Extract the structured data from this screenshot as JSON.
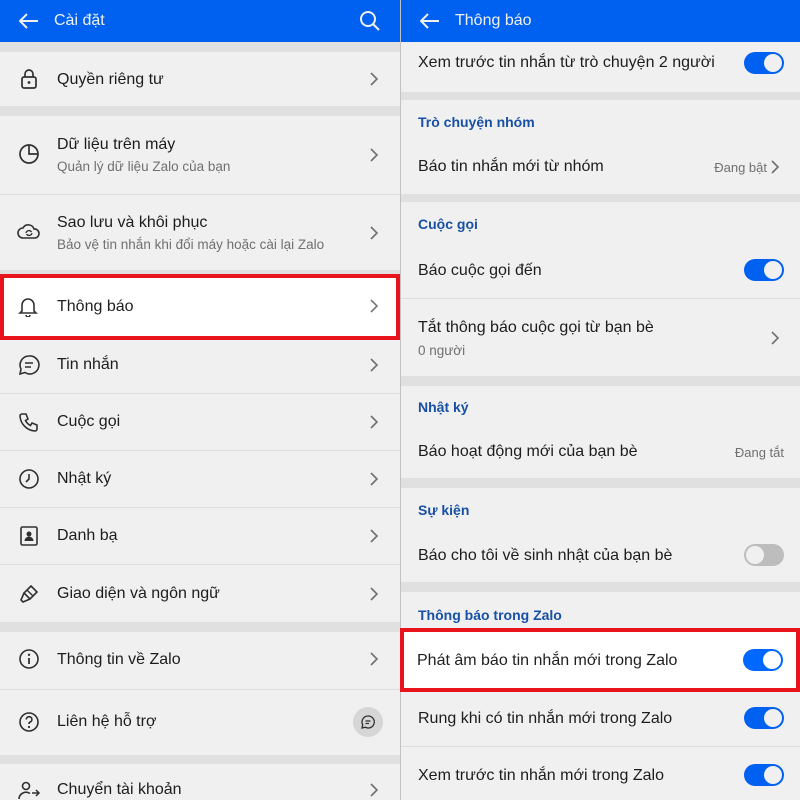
{
  "left": {
    "title": "Cài đặt",
    "items": [
      {
        "label": "Quyền riêng tư",
        "icon": "lock-icon"
      },
      {
        "label": "Dữ liệu trên máy",
        "sub": "Quản lý dữ liệu Zalo của bạn",
        "icon": "pie-chart-icon"
      },
      {
        "label": "Sao lưu và khôi phục",
        "sub": "Bảo vệ tin nhắn khi đổi máy hoặc cài lại Zalo",
        "icon": "cloud-sync-icon"
      },
      {
        "label": "Thông báo",
        "icon": "bell-icon"
      },
      {
        "label": "Tin nhắn",
        "icon": "chat-bubble-icon"
      },
      {
        "label": "Cuộc gọi",
        "icon": "phone-icon"
      },
      {
        "label": "Nhật ký",
        "icon": "clock-icon"
      },
      {
        "label": "Danh bạ",
        "icon": "contact-book-icon"
      },
      {
        "label": "Giao diện và ngôn ngữ",
        "icon": "paint-brush-icon"
      },
      {
        "label": "Thông tin về Zalo",
        "icon": "info-icon"
      },
      {
        "label": "Liên hệ hỗ trợ",
        "icon": "help-icon"
      },
      {
        "label": "Chuyển tài khoản",
        "icon": "switch-account-icon"
      }
    ]
  },
  "right": {
    "title": "Thông báo",
    "rows": {
      "preview_direct": "Xem trước tin nhắn từ trò chuyện 2 người",
      "group_section": "Trò chuyện nhóm",
      "group_new": "Báo tin nhắn mới từ nhóm",
      "group_new_status": "Đang bật",
      "call_section": "Cuộc gọi",
      "incoming_call": "Báo cuộc gọi đến",
      "mute_calls": "Tắt thông báo cuộc gọi từ bạn bè",
      "mute_calls_sub": "0 người",
      "diary_section": "Nhật ký",
      "friend_activity": "Báo hoạt động mới của bạn bè",
      "friend_activity_status": "Đang tắt",
      "event_section": "Sự kiện",
      "birthday": "Báo cho tôi về sinh nhật của bạn bè",
      "in_app_section": "Thông báo trong Zalo",
      "sound": "Phát âm báo tin nhắn mới trong Zalo",
      "vibrate": "Rung khi có tin nhắn mới trong Zalo",
      "preview_in_app": "Xem trước tin nhắn mới trong Zalo"
    },
    "toggles": {
      "preview_direct": true,
      "incoming_call": true,
      "birthday": false,
      "sound": true,
      "vibrate": true,
      "preview_in_app": true
    }
  },
  "colors": {
    "brand": "#0068ff",
    "highlight": "#e8141b",
    "section_text": "#1a56b0"
  }
}
